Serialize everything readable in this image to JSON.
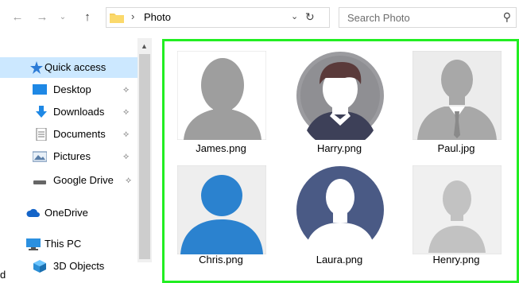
{
  "navigation": {
    "back_icon": "arrow-left-icon",
    "forward_icon": "arrow-right-icon",
    "recent_icon": "chevron-down-icon",
    "up_icon": "arrow-up-icon"
  },
  "address_bar": {
    "folder_icon": "folder-icon",
    "separator": "›",
    "path": "Photo",
    "dropdown_icon": "chevron-down-icon",
    "refresh_icon": "refresh-icon"
  },
  "search": {
    "placeholder": "Search Photo",
    "icon": "search-icon"
  },
  "sidebar": {
    "items": [
      {
        "label": "Quick access",
        "icon": "star-icon",
        "pinned": false,
        "active": true
      },
      {
        "label": "Desktop",
        "icon": "desktop-icon",
        "pinned": true
      },
      {
        "label": "Downloads",
        "icon": "download-arrow-icon",
        "pinned": true
      },
      {
        "label": "Documents",
        "icon": "document-icon",
        "pinned": true
      },
      {
        "label": "Pictures",
        "icon": "pictures-icon",
        "pinned": true
      },
      {
        "label": "Google Drive",
        "icon": "drive-icon",
        "pinned": true
      },
      {
        "label": "OneDrive",
        "icon": "cloud-icon",
        "pinned": false
      },
      {
        "label": "This PC",
        "icon": "computer-icon",
        "pinned": false
      },
      {
        "label": "3D Objects",
        "icon": "cube-icon",
        "pinned": false
      }
    ],
    "pin_glyph": "📌",
    "stray_text": "d"
  },
  "files": [
    {
      "name": "James.png",
      "avatar": "gray-male-silhouette"
    },
    {
      "name": "Harry.png",
      "avatar": "circle-male-avatar"
    },
    {
      "name": "Paul.jpg",
      "avatar": "suit-male-silhouette"
    },
    {
      "name": "Chris.png",
      "avatar": "blue-user-avatar"
    },
    {
      "name": "Laura.png",
      "avatar": "circle-navy-avatar"
    },
    {
      "name": "Henry.png",
      "avatar": "light-gray-silhouette"
    }
  ],
  "colors": {
    "selection_border": "#22ee22",
    "active_sidebar": "#cce8ff",
    "blue_avatar": "#2b82cf",
    "navy_avatar": "#4a5a85"
  }
}
